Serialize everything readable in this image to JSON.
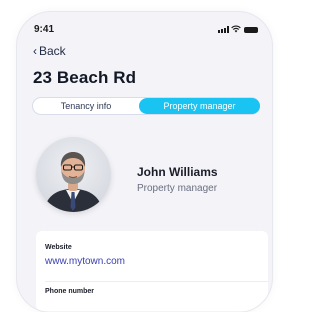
{
  "status_bar": {
    "time": "9:41"
  },
  "nav": {
    "back_label": "Back",
    "back_icon": "chevron-left-icon"
  },
  "page": {
    "title": "23 Beach Rd"
  },
  "tabs": [
    {
      "label": "Tenancy info",
      "selected": false
    },
    {
      "label": "Property manager",
      "selected": true
    }
  ],
  "profile": {
    "name": "John Williams",
    "role": "Property manager"
  },
  "details": {
    "website_label": "Website",
    "website_value": "www.mytown.com",
    "next_label": "Phone number"
  },
  "colors": {
    "accent": "#19c4f2",
    "link": "#3a3fb0",
    "background": "#f3f3f8"
  }
}
